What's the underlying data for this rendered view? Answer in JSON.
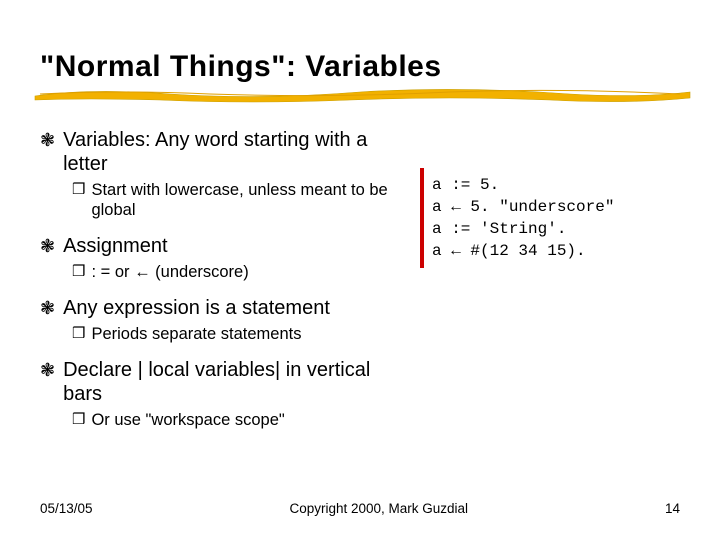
{
  "title": "\"Normal Things\": Variables",
  "bullets": [
    {
      "level": 1,
      "text": "Variables: Any word starting with a letter"
    },
    {
      "level": 2,
      "text": "Start with lowercase, unless meant to be global"
    },
    {
      "level": 1,
      "text": "Assignment"
    },
    {
      "level": 2,
      "text": ": = or ← (underscore)"
    },
    {
      "level": 1,
      "text": "Any expression is a statement"
    },
    {
      "level": 2,
      "text": "Periods separate statements"
    },
    {
      "level": 1,
      "text": "Declare | local variables| in vertical bars"
    },
    {
      "level": 2,
      "text": "Or use \"workspace scope\""
    }
  ],
  "code_lines": [
    "a := 5.",
    "a ← 5. \"underscore\"",
    "a := 'String'.",
    "a ← #(12 34 15)."
  ],
  "bullet_glyphs": {
    "l1": "❃",
    "l2": "❒"
  },
  "footer": {
    "date": "05/13/05",
    "copyright": "Copyright 2000, Mark Guzdial",
    "page": "14"
  },
  "colors": {
    "underline": "#f2b100",
    "code_border": "#cc0000"
  }
}
